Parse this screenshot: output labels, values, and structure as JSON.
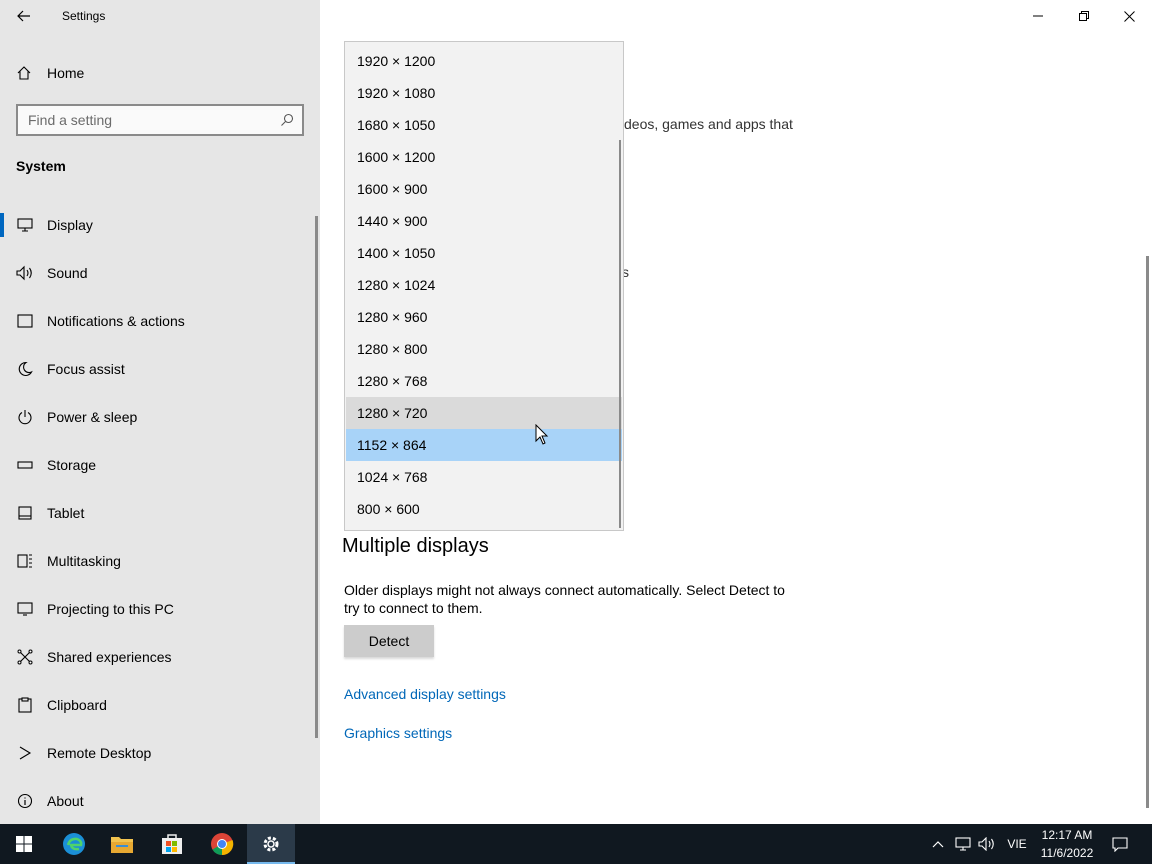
{
  "window": {
    "title": "Settings"
  },
  "sidebar": {
    "home_label": "Home",
    "search_placeholder": "Find a setting",
    "section_title": "System",
    "items": [
      {
        "label": "Display",
        "icon": "monitor-icon",
        "active": true
      },
      {
        "label": "Sound",
        "icon": "speaker-icon"
      },
      {
        "label": "Notifications & actions",
        "icon": "notification-icon"
      },
      {
        "label": "Focus assist",
        "icon": "moon-icon"
      },
      {
        "label": "Power & sleep",
        "icon": "power-icon"
      },
      {
        "label": "Storage",
        "icon": "storage-icon"
      },
      {
        "label": "Tablet",
        "icon": "tablet-icon"
      },
      {
        "label": "Multitasking",
        "icon": "multitasking-icon"
      },
      {
        "label": "Projecting to this PC",
        "icon": "projecting-icon"
      },
      {
        "label": "Shared experiences",
        "icon": "shared-experiences-icon"
      },
      {
        "label": "Clipboard",
        "icon": "clipboard-icon"
      },
      {
        "label": "Remote Desktop",
        "icon": "remote-desktop-icon"
      },
      {
        "label": "About",
        "icon": "info-icon"
      }
    ]
  },
  "main": {
    "partial_text_1": "deos, games and apps that",
    "partial_text_2": "s",
    "resolution_dropdown": {
      "options": [
        "1920 × 1200",
        "1920 × 1080",
        "1680 × 1050",
        "1600 × 1200",
        "1600 × 900",
        "1440 × 900",
        "1400 × 1050",
        "1280 × 1024",
        "1280 × 960",
        "1280 × 800",
        "1280 × 768",
        "1280 × 720",
        "1152 × 864",
        "1024 × 768",
        "800 × 600"
      ],
      "hovered": "1280 × 720",
      "selected": "1152 × 864"
    },
    "multiple_displays": {
      "heading": "Multiple displays",
      "description": "Older displays might not always connect automatically. Select Detect to try to connect to them.",
      "detect_label": "Detect"
    },
    "links": {
      "advanced": "Advanced display settings",
      "graphics": "Graphics settings"
    }
  },
  "taskbar": {
    "apps": [
      "start-icon",
      "edge-icon",
      "file-explorer-icon",
      "store-icon",
      "chrome-icon",
      "settings-icon"
    ],
    "language": "VIE",
    "time": "12:17 AM",
    "date": "11/6/2022"
  },
  "colors": {
    "accent": "#0067c0",
    "link": "#0067b8",
    "selected": "#a8d3f8",
    "taskbar": "#101820"
  }
}
